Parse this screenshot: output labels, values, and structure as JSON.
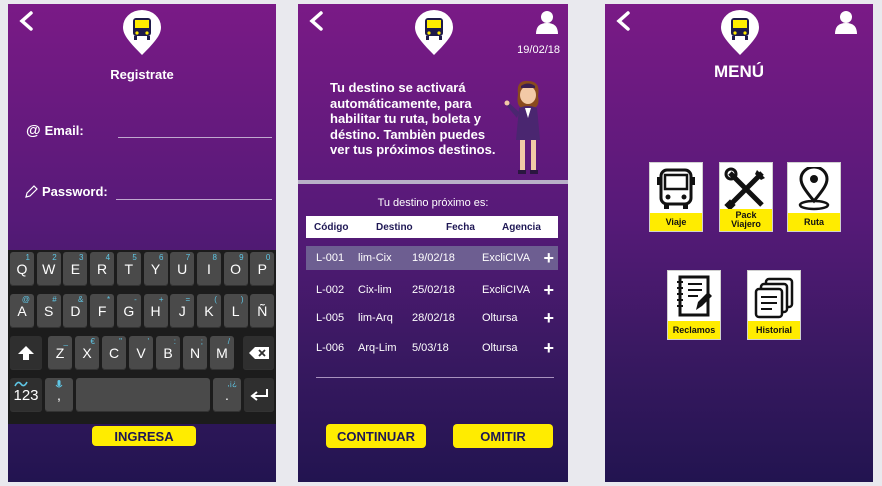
{
  "register": {
    "title": "Registrate",
    "email_label": "Email:",
    "password_label": "Password:",
    "submit_label": "INGRESA",
    "keyboard": {
      "row1": [
        {
          "k": "Q",
          "s": "1"
        },
        {
          "k": "W",
          "s": "2"
        },
        {
          "k": "E",
          "s": "3"
        },
        {
          "k": "R",
          "s": "4"
        },
        {
          "k": "T",
          "s": "5"
        },
        {
          "k": "Y",
          "s": "6"
        },
        {
          "k": "U",
          "s": "7"
        },
        {
          "k": "I",
          "s": "8"
        },
        {
          "k": "O",
          "s": "9"
        },
        {
          "k": "P",
          "s": "0"
        }
      ],
      "row2": [
        {
          "k": "A",
          "s": "@"
        },
        {
          "k": "S",
          "s": "#"
        },
        {
          "k": "D",
          "s": "&"
        },
        {
          "k": "F",
          "s": "*"
        },
        {
          "k": "G",
          "s": "-"
        },
        {
          "k": "H",
          "s": "+"
        },
        {
          "k": "J",
          "s": "="
        },
        {
          "k": "K",
          "s": "("
        },
        {
          "k": "L",
          "s": ")"
        },
        {
          "k": "Ñ",
          "s": ""
        }
      ],
      "row3": [
        {
          "k": "Z",
          "s": "_"
        },
        {
          "k": "X",
          "s": "€"
        },
        {
          "k": "C",
          "s": "\""
        },
        {
          "k": "V",
          "s": "'"
        },
        {
          "k": "B",
          "s": ":"
        },
        {
          "k": "N",
          "s": ";"
        },
        {
          "k": "M",
          "s": "/"
        }
      ],
      "numbers_key": "123",
      "comma_key": ",",
      "period_key": ".",
      "punct_hint": ",¡¿"
    }
  },
  "destinations": {
    "date": "19/02/18",
    "message": "Tu destino se activará automáticamente, para habilitar tu ruta, boleta y déstino. Tambièn puedes ver tus próximos destinos.",
    "next_label": "Tu destino próximo es:",
    "columns": [
      "Código",
      "Destino",
      "Fecha",
      "Agencia"
    ],
    "rows": [
      {
        "code": "L-001",
        "dest": "lim-Cix",
        "date": "19/02/18",
        "agency": "ExcliCIVA",
        "selected": true
      },
      {
        "code": "L-002",
        "dest": "Cix-lim",
        "date": "25/02/18",
        "agency": "ExcliCIVA",
        "selected": false
      },
      {
        "code": "L-005",
        "dest": "lim-Arq",
        "date": "28/02/18",
        "agency": "Oltursa",
        "selected": false
      },
      {
        "code": "L-006",
        "dest": "Arq-Lim",
        "date": "5/03/18",
        "agency": "Oltursa",
        "selected": false
      }
    ],
    "continue_label": "CONTINUAR",
    "skip_label": "OMITIR"
  },
  "menu": {
    "title": "MENÚ",
    "items": [
      {
        "label": "Viaje",
        "icon": "bus-icon"
      },
      {
        "label": "Pack Viajero",
        "icon": "tools-icon"
      },
      {
        "label": "Ruta",
        "icon": "map-pin-icon"
      },
      {
        "label": "Reclamos",
        "icon": "complaint-book-icon"
      },
      {
        "label": "Historial",
        "icon": "history-icon"
      }
    ]
  },
  "colors": {
    "accent_yellow": "#ffec00",
    "gradient_top": "#7a1a86",
    "gradient_bottom": "#221450"
  }
}
